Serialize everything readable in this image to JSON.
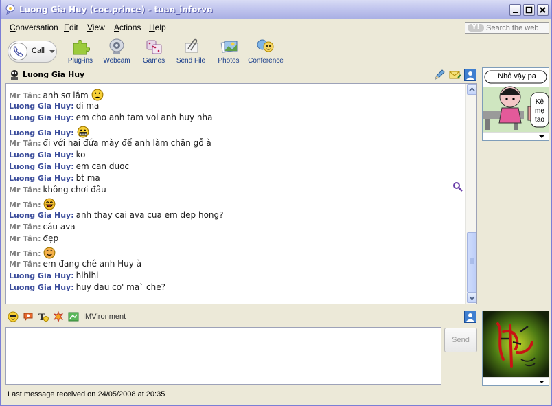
{
  "window": {
    "title": "Luong Gia Huy (coc.prince) - tuan_inforvn"
  },
  "menu": {
    "items": [
      {
        "label": "Conversation"
      },
      {
        "label": "Edit"
      },
      {
        "label": "View"
      },
      {
        "label": "Actions"
      },
      {
        "label": "Help"
      }
    ]
  },
  "search": {
    "placeholder": "Search the web",
    "brand_badge": "Y!"
  },
  "toolbar": {
    "call_label": "Call",
    "tools": [
      {
        "label": "Plug-ins",
        "icon": "puzzle-icon"
      },
      {
        "label": "Webcam",
        "icon": "webcam-icon"
      },
      {
        "label": "Games",
        "icon": "dice-icon"
      },
      {
        "label": "Send File",
        "icon": "paperclip-icon"
      },
      {
        "label": "Photos",
        "icon": "photos-icon"
      },
      {
        "label": "Conference",
        "icon": "conference-icon"
      }
    ]
  },
  "contact": {
    "name": "Luong Gia Huy"
  },
  "conversation": {
    "messages": [
      {
        "sender": "Mr Tân:",
        "text": "anh sơ lắm",
        "emoticon": "confused",
        "mine": false
      },
      {
        "sender": "Luong Gia Huy:",
        "text": "di ma",
        "emoticon": null,
        "mine": true
      },
      {
        "sender": "Luong Gia Huy:",
        "text": "em cho anh tam voi anh huy nha",
        "emoticon": null,
        "mine": true
      },
      {
        "sender": "Luong Gia Huy:",
        "text": "",
        "emoticon": "grin-teeth",
        "mine": true
      },
      {
        "sender": "Mr Tân:",
        "text": "đi với hai đứa mày để anh làm chân gỗ à",
        "emoticon": null,
        "mine": false
      },
      {
        "sender": "Luong Gia Huy:",
        "text": "ko",
        "emoticon": null,
        "mine": true
      },
      {
        "sender": "Luong Gia Huy:",
        "text": "em can duoc",
        "emoticon": null,
        "mine": true
      },
      {
        "sender": "Luong Gia Huy:",
        "text": "bt ma",
        "emoticon": null,
        "mine": true
      },
      {
        "sender": "Mr Tân:",
        "text": "không chơi đâu",
        "emoticon": null,
        "mine": false
      },
      {
        "sender": "Mr Tân:",
        "text": "",
        "emoticon": "laughing",
        "mine": false
      },
      {
        "sender": "Luong Gia Huy:",
        "text": "anh thay cai ava cua em dep hong?",
        "emoticon": null,
        "mine": true
      },
      {
        "sender": "Mr Tân:",
        "text": "cáu ava",
        "emoticon": null,
        "mine": false
      },
      {
        "sender": "Mr Tân:",
        "text": "đẹp",
        "emoticon": null,
        "mine": false
      },
      {
        "sender": "Mr Tân:",
        "text": "",
        "emoticon": "blush",
        "mine": false
      },
      {
        "sender": "Mr Tân:",
        "text": "em đang chê anh Huy à",
        "emoticon": null,
        "mine": false
      },
      {
        "sender": "Luong Gia Huy:",
        "text": "hihihi",
        "emoticon": null,
        "mine": true
      },
      {
        "sender": "Luong Gia Huy:",
        "text": "huy dau co' ma` che?",
        "emoticon": null,
        "mine": true
      }
    ]
  },
  "formatbar": {
    "imvironment_label": "IMVironment"
  },
  "input": {
    "value": "",
    "send_label": "Send"
  },
  "buddy_avatar": {
    "bubble_top": "Nhỏ vậy pa",
    "bubble_side": "Kệ mẹ tao"
  },
  "status": {
    "text": "Last message received on 24/05/2008 at 20:35"
  },
  "colors": {
    "titlebar": "#aab0e4",
    "my_sender": "#3a4c9b",
    "other_sender": "#808080",
    "toolbar_label": "#1a3e8c"
  }
}
